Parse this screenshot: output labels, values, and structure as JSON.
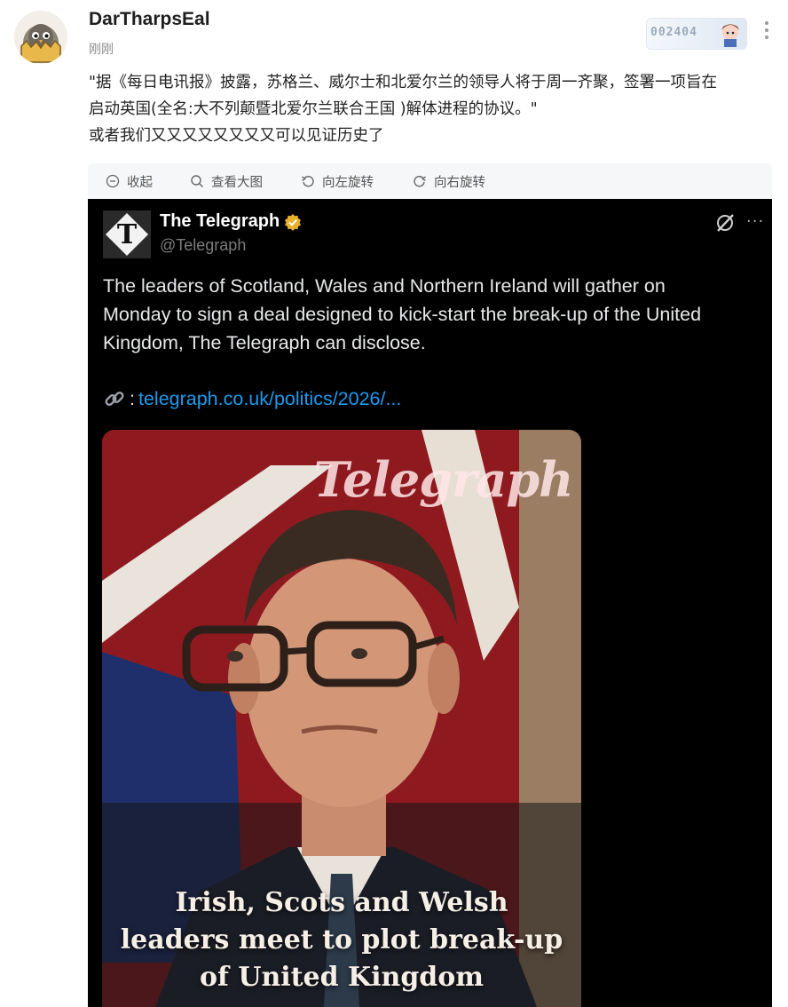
{
  "post": {
    "username": "DarTharpsEal",
    "timestamp": "刚刚",
    "badge_number": "002404",
    "text_lines": [
      "\"据《每日电讯报》披露，苏格兰、威尔士和北爱尔兰的领导人将于周一齐聚，签署一项旨在",
      "启动英国(全名:大不列颠暨北爱尔兰联合王国 )解体进程的协议。\"",
      "或者我们又又又又又又又又可以见证历史了"
    ]
  },
  "toolbar": {
    "collapse_label": "收起",
    "view_large_label": "查看大图",
    "rotate_left_label": "向左旋转",
    "rotate_right_label": "向右旋转"
  },
  "tweet": {
    "account_name": "The Telegraph",
    "handle": "@Telegraph",
    "more": "···",
    "body_lines": [
      "The leaders of Scotland, Wales and Northern Ireland will gather on",
      "Monday to sign a deal designed to kick-start the break-up of the United",
      "Kingdom, The Telegraph can disclose."
    ],
    "link_prefix": ":",
    "link_text": "telegraph.co.uk/politics/2026/...",
    "logo_letter": "T",
    "image_wordmark": "Telegraph",
    "image_headline_lines": [
      "Irish, Scots and Welsh",
      "leaders meet to plot break-up",
      "of United Kingdom"
    ]
  },
  "colors": {
    "link_blue": "#1d9bf0",
    "verified_gold": "#e8b12b"
  },
  "icons": [
    "avatar-egg-bird",
    "collapse-icon",
    "search-icon",
    "rotate-left-icon",
    "rotate-right-icon",
    "verified-badge-icon",
    "grok-icon",
    "link-icon"
  ]
}
